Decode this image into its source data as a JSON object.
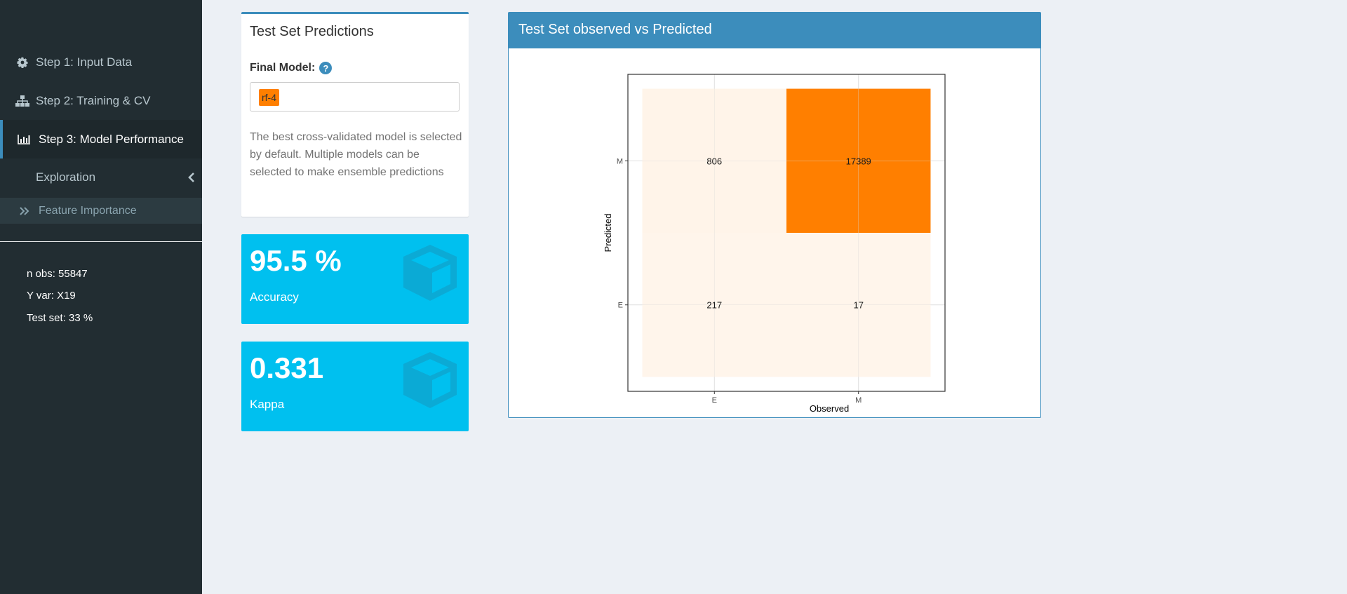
{
  "sidebar": {
    "items": [
      {
        "label": "Step 1: Input Data",
        "icon": "gear-icon"
      },
      {
        "label": "Step 2: Training & CV",
        "icon": "sitemap-icon"
      },
      {
        "label": "Step 3: Model Performance",
        "icon": "bar-chart-icon",
        "active": true
      }
    ],
    "submenu": {
      "label": "Exploration",
      "icon": "chevron-left-icon"
    },
    "subitems": [
      {
        "label": "Feature Importance",
        "icon": "double-chevron-right-icon"
      }
    ],
    "info": {
      "n_obs": "n obs: 55847",
      "y_var": "Y var: X19",
      "test_set": "Test set: 33 %"
    }
  },
  "predictions": {
    "title": "Test Set Predictions",
    "final_model_label": "Final Model:",
    "help_icon": "?",
    "selected_model": "rf-4",
    "help_text": "The best cross-validated model is selected by default. Multiple models can be selected to make ensemble predictions"
  },
  "metrics": [
    {
      "value": "95.5 %",
      "label": "Accuracy",
      "icon": "cube-icon"
    },
    {
      "value": "0.331",
      "label": "Kappa",
      "icon": "cube-icon"
    }
  ],
  "chart_box": {
    "title": "Test Set observed vs Predicted"
  },
  "chart_data": {
    "type": "heatmap",
    "x_categories": [
      "E",
      "M"
    ],
    "y_categories": [
      "E",
      "M"
    ],
    "xlabel": "Observed",
    "ylabel": "Predicted",
    "cells": [
      {
        "x": "E",
        "y": "M",
        "value": 806
      },
      {
        "x": "M",
        "y": "M",
        "value": 17389
      },
      {
        "x": "E",
        "y": "E",
        "value": 217
      },
      {
        "x": "M",
        "y": "E",
        "value": 17
      }
    ],
    "color_low": "#fff5eb",
    "color_high": "#ff7f00",
    "grid": true
  },
  "colors": {
    "sidebar_bg": "#222d32",
    "accent": "#3c8dbc",
    "value_box": "#00c0ef",
    "tag": "#ff7f00"
  }
}
